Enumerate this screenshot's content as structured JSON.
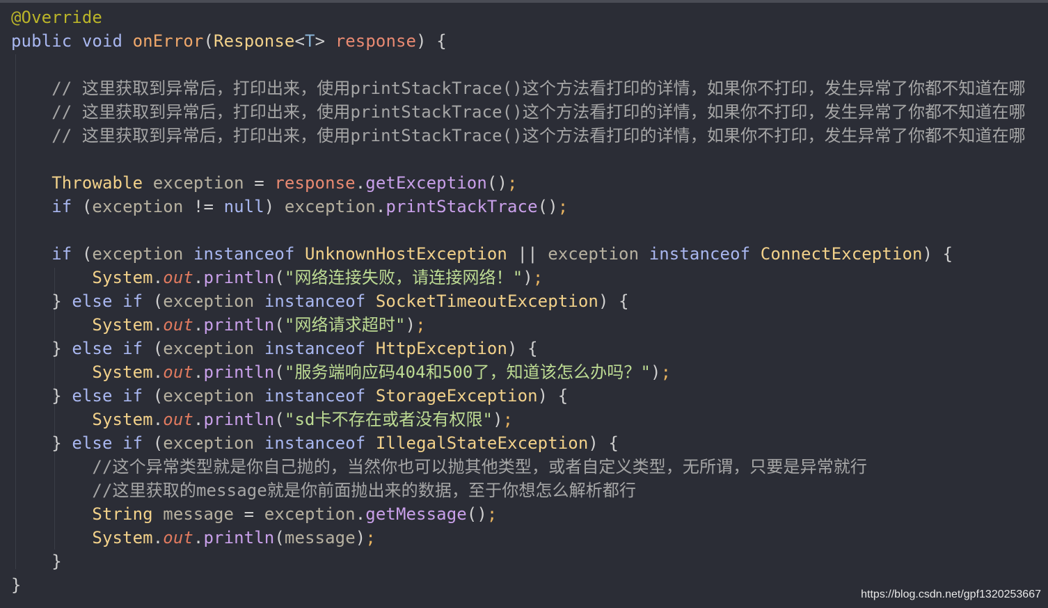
{
  "watermark": "https://blog.csdn.net/gpf1320253667",
  "code": {
    "annotation": "@Override",
    "sig_public": "public",
    "sig_void": "void",
    "sig_method": "onError",
    "sig_type": "Response",
    "sig_generic_open": "<",
    "sig_generic_t": "T",
    "sig_generic_close": ">",
    "sig_param": "response",
    "sig_rest": ") {",
    "comment_line": "// 这里获取到异常后，打印出来，使用printStackTrace()这个方法看打印的详情，如果你不打印，发生异常了你都不知道在哪",
    "throwable_type": "Throwable",
    "var_exception": "exception",
    "assign": " = ",
    "response_ref": "response",
    "get_exception": "getException",
    "paren_semi": "();",
    "kw_if": "if",
    "open_paren": " (",
    "neq": " != ",
    "kw_null": "null",
    "close_paren_sp": ") ",
    "print_stack_trace": "printStackTrace",
    "kw_instanceof": "instanceof",
    "unknown_host": "UnknownHostException",
    "or_op": " || ",
    "connect_exc": "ConnectException",
    "close_brace_open": ") {",
    "system": "System",
    "out": "out",
    "println": "println",
    "msg_network_fail": "\"网络连接失败，请连接网络！\"",
    "else_brace": "} ",
    "kw_else": "else",
    "socket_timeout": "SocketTimeoutException",
    "msg_timeout": "\"网络请求超时\"",
    "http_exc": "HttpException",
    "msg_http": "\"服务端响应码404和500了，知道该怎么办吗？\"",
    "storage_exc": "StorageException",
    "msg_storage": "\"sd卡不存在或者没有权限\"",
    "illegal_state": "IllegalStateException",
    "comment_custom1": "//这个异常类型就是你自己抛的，当然你也可以抛其他类型，或者自定义类型，无所谓，只要是异常就行",
    "comment_custom2": "//这里获取的message就是你前面抛出来的数据，至于你想怎么解析都行",
    "string_type": "String",
    "var_message": "message",
    "get_message": "getMessage",
    "close_brace": "}"
  }
}
